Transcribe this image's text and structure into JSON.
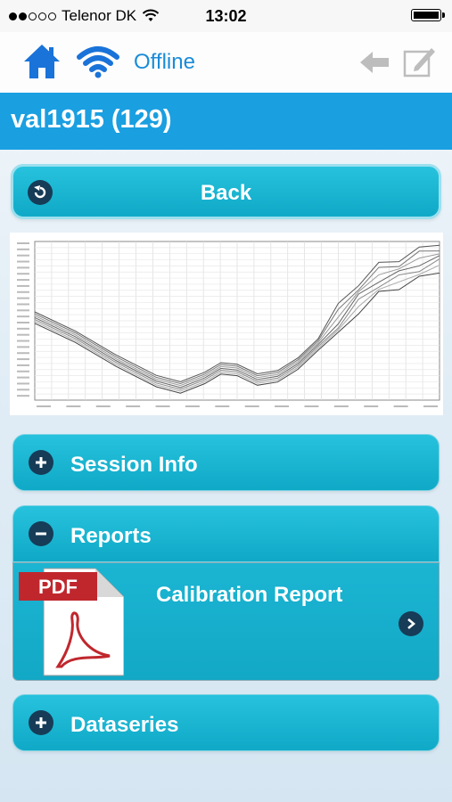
{
  "status": {
    "carrier": "Telenor DK",
    "time": "13:02"
  },
  "nav": {
    "offline_label": "Offline"
  },
  "title": "val1915 (129)",
  "back_button": {
    "label": "Back"
  },
  "sections": [
    {
      "label": "Session Info",
      "expanded": false
    },
    {
      "label": "Reports",
      "expanded": true
    },
    {
      "label": "Dataseries",
      "expanded": false
    }
  ],
  "report": {
    "title": "Calibration Report",
    "pdf_badge": "PDF"
  },
  "chart_data": {
    "type": "line",
    "series_count": 7,
    "grid": true,
    "axis_labels_legible": false
  },
  "colors": {
    "accent": "#1a9fe1",
    "button": "#17b3d1",
    "icon_dark": "#163c57"
  }
}
